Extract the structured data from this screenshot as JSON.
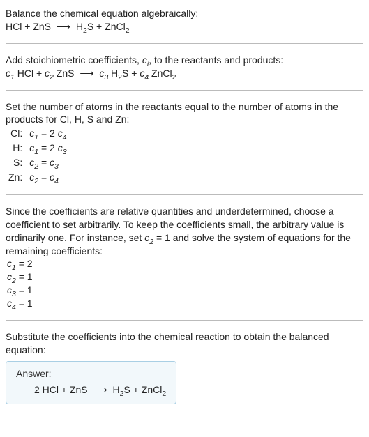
{
  "intro": {
    "prompt": "Balance the chemical equation algebraically:",
    "lhs1": "HCl",
    "plus": " + ",
    "lhs2": "ZnS",
    "arrow": "⟶",
    "rhs1a": "H",
    "rhs1sub": "2",
    "rhs1b": "S",
    "rhs2a": "ZnCl",
    "rhs2sub": "2"
  },
  "step1": {
    "text_a": "Add stoichiometric coefficients, ",
    "ci": "c",
    "ci_sub": "i",
    "text_b": ", to the reactants and products:",
    "c1": "c",
    "s1": "1",
    "t1": " HCl",
    "c2": "c",
    "s2": "2",
    "t2": " ZnS",
    "arrow": "⟶",
    "c3": "c",
    "s3": "3",
    "t3a": " H",
    "t3sub": "2",
    "t3b": "S",
    "c4": "c",
    "s4": "4",
    "t4a": " ZnCl",
    "t4sub": "2"
  },
  "step2": {
    "text": "Set the number of atoms in the reactants equal to the number of atoms in the products for Cl, H, S and Zn:",
    "rows": {
      "Cl": {
        "el": "Cl:",
        "l": "c",
        "ls": "1",
        "eq": " = 2 ",
        "r": "c",
        "rs": "4"
      },
      "H": {
        "el": "H:",
        "l": "c",
        "ls": "1",
        "eq": " = 2 ",
        "r": "c",
        "rs": "3"
      },
      "S": {
        "el": "S:",
        "l": "c",
        "ls": "2",
        "eq": " = ",
        "r": "c",
        "rs": "3"
      },
      "Zn": {
        "el": "Zn:",
        "l": "c",
        "ls": "2",
        "eq": " = ",
        "r": "c",
        "rs": "4"
      }
    }
  },
  "step3": {
    "text_a": "Since the coefficients are relative quantities and underdetermined, choose a coefficient to set arbitrarily. To keep the coefficients small, the arbitrary value is ordinarily one. For instance, set ",
    "cv": "c",
    "cs": "2",
    "cval": " = 1",
    "text_b": " and solve the system of equations for the remaining coefficients:",
    "c1": {
      "v": "c",
      "s": "1",
      "r": " = 2"
    },
    "c2": {
      "v": "c",
      "s": "2",
      "r": " = 1"
    },
    "c3": {
      "v": "c",
      "s": "3",
      "r": " = 1"
    },
    "c4": {
      "v": "c",
      "s": "4",
      "r": " = 1"
    }
  },
  "step4": {
    "text": "Substitute the coefficients into the chemical reaction to obtain the balanced equation:"
  },
  "answer": {
    "label": "Answer:",
    "lhs": "2 HCl + ZnS",
    "arrow": "⟶",
    "r1a": "H",
    "r1s": "2",
    "r1b": "S",
    "plus": " + ",
    "r2a": "ZnCl",
    "r2s": "2"
  }
}
